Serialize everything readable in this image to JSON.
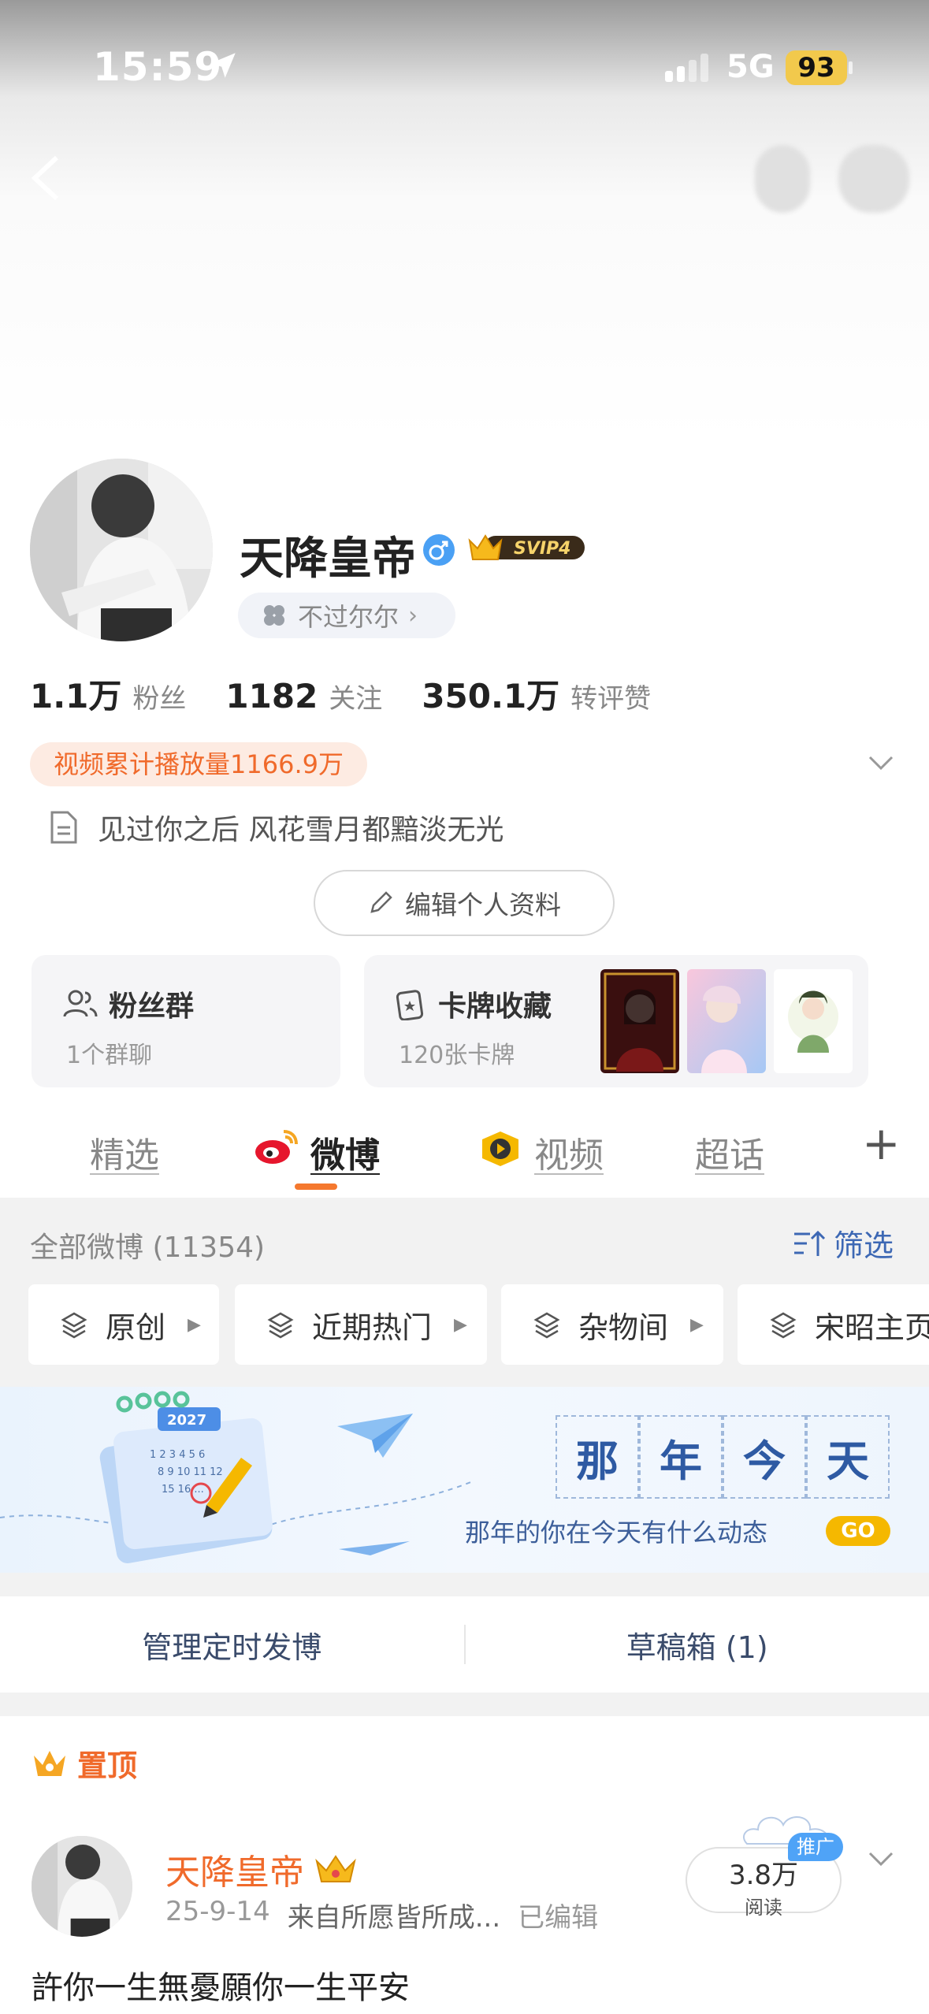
{
  "status_bar": {
    "time": "15:59",
    "network": "5G",
    "battery": "93"
  },
  "profile": {
    "name": "天降皇帝",
    "vip_badge": "SVIP4",
    "tag": "不过尔尔",
    "stats": [
      {
        "value": "1.1万",
        "label": "粉丝"
      },
      {
        "value": "1182",
        "label": "关注"
      },
      {
        "value": "350.1万",
        "label": "转评赞"
      }
    ],
    "video_views": "视频累计播放量1166.9万",
    "bio": "见过你之后 风花雪月都黯淡无光",
    "edit_button": "编辑个人资料"
  },
  "cards": {
    "fans_group": {
      "title": "粉丝群",
      "sub": "1个群聊"
    },
    "card_collection": {
      "title": "卡牌收藏",
      "sub": "120张卡牌"
    }
  },
  "tabs": [
    {
      "label": "精选"
    },
    {
      "label": "微博"
    },
    {
      "label": "视频"
    },
    {
      "label": "超话"
    }
  ],
  "filter": {
    "all_label": "全部微博 (11354)",
    "filter_label": "筛选",
    "chips": [
      "原创",
      "近期热门",
      "杂物间",
      "宋昭主页"
    ]
  },
  "banner": {
    "chars": [
      "那",
      "年",
      "今",
      "天"
    ],
    "subtitle": "那年的你在今天有什么动态",
    "go": "GO"
  },
  "actions": {
    "scheduled": "管理定时发博",
    "drafts": "草稿箱 (1)"
  },
  "post": {
    "pinned": "置顶",
    "author": "天降皇帝",
    "date": "25-9-14",
    "source": "来自所愿皆所成...",
    "edited": "已编辑",
    "reads_value": "3.8万",
    "reads_label": "阅读",
    "promo": "推广",
    "text": "許你一生無憂願你一生平安"
  },
  "colors": {
    "accent": "#f06a2b",
    "link": "#3d68b4",
    "tab_indicator": "#f5782e",
    "go": "#f5b800"
  }
}
